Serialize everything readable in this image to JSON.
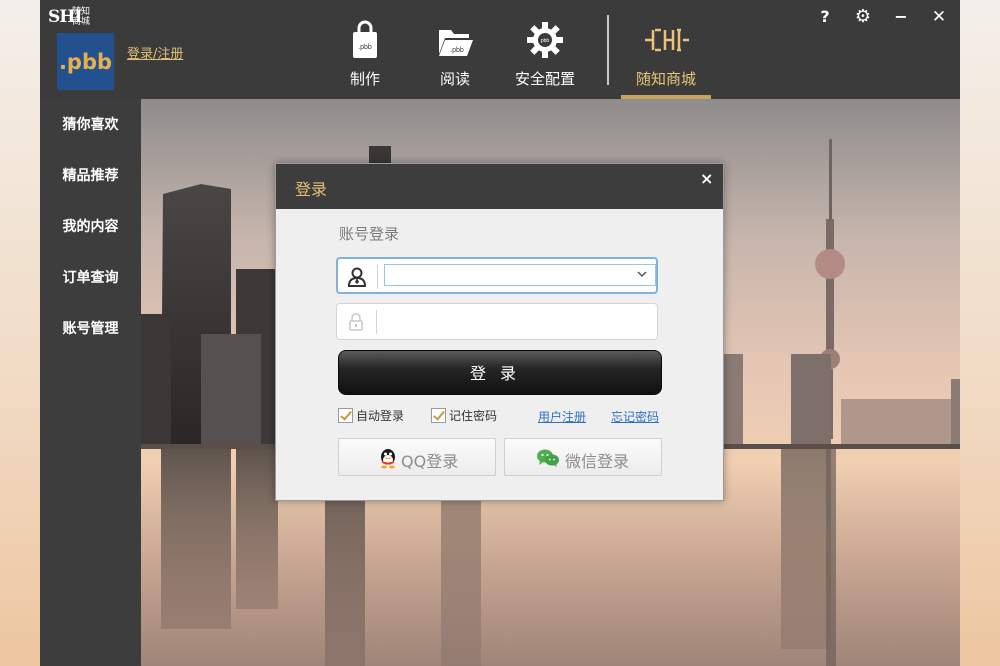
{
  "app": {
    "logo_text": "随知\n商城",
    "logo_mark": "SHI",
    "brand_box": ".pbb",
    "login_register_link": "登录/注册"
  },
  "nav": {
    "make": "制作",
    "read": "阅读",
    "security": "安全配置",
    "shop": "随知商城"
  },
  "window_controls": {
    "help": "?",
    "settings": "⚙",
    "minimize": "−",
    "close": "✕"
  },
  "sidebar": {
    "items": [
      {
        "label": "猜你喜欢"
      },
      {
        "label": "精品推荐"
      },
      {
        "label": "我的内容"
      },
      {
        "label": "订单查询"
      },
      {
        "label": "账号管理"
      }
    ]
  },
  "dialog": {
    "title": "登录",
    "close": "×",
    "section_title": "账号登录",
    "account_value": "",
    "password_value": "",
    "login_button": "登录",
    "auto_login": "自动登录",
    "remember_password": "记住密码",
    "register": "用户注册",
    "forgot_password": "忘记密码",
    "qq_login": "QQ登录",
    "wechat_login": "微信登录"
  },
  "colors": {
    "chrome": "#3d3d3d",
    "accent_gold": "#e2bf76",
    "brand_blue": "#23508f",
    "link_blue": "#2d6fc4"
  }
}
